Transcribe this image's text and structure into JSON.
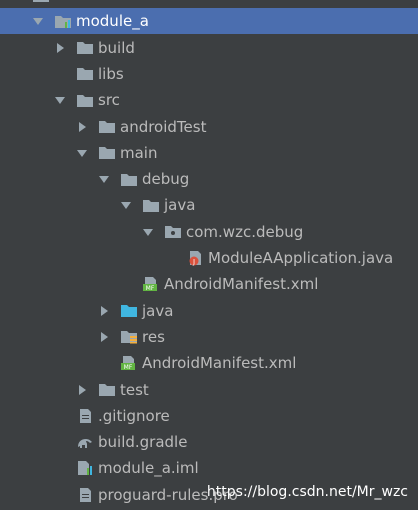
{
  "tree": {
    "items": [
      {
        "label": "",
        "depth": 0,
        "arrow": "down",
        "icon": "folder-icon",
        "selected": false,
        "clipped": true
      },
      {
        "label": "module_a",
        "depth": 1,
        "arrow": "down",
        "icon": "module-folder-icon",
        "selected": true
      },
      {
        "label": "build",
        "depth": 2,
        "arrow": "right",
        "icon": "folder-icon"
      },
      {
        "label": "libs",
        "depth": 2,
        "arrow": "none",
        "icon": "folder-icon"
      },
      {
        "label": "src",
        "depth": 2,
        "arrow": "down",
        "icon": "folder-icon"
      },
      {
        "label": "androidTest",
        "depth": 3,
        "arrow": "right",
        "icon": "folder-icon"
      },
      {
        "label": "main",
        "depth": 3,
        "arrow": "down",
        "icon": "folder-icon"
      },
      {
        "label": "debug",
        "depth": 4,
        "arrow": "down",
        "icon": "folder-icon"
      },
      {
        "label": "java",
        "depth": 5,
        "arrow": "down",
        "icon": "folder-icon"
      },
      {
        "label": "com.wzc.debug",
        "depth": 6,
        "arrow": "down",
        "icon": "package-icon"
      },
      {
        "label": "ModuleAApplication.java",
        "depth": 7,
        "arrow": "none",
        "icon": "java-class-icon"
      },
      {
        "label": "AndroidManifest.xml",
        "depth": 5,
        "arrow": "none",
        "icon": "manifest-icon"
      },
      {
        "label": "java",
        "depth": 4,
        "arrow": "right",
        "icon": "source-folder-icon"
      },
      {
        "label": "res",
        "depth": 4,
        "arrow": "right",
        "icon": "resource-folder-icon"
      },
      {
        "label": "AndroidManifest.xml",
        "depth": 4,
        "arrow": "none",
        "icon": "manifest-icon"
      },
      {
        "label": "test",
        "depth": 3,
        "arrow": "right",
        "icon": "folder-icon"
      },
      {
        "label": ".gitignore",
        "depth": 2,
        "arrow": "none",
        "icon": "text-file-icon"
      },
      {
        "label": "build.gradle",
        "depth": 2,
        "arrow": "none",
        "icon": "gradle-icon"
      },
      {
        "label": "module_a.iml",
        "depth": 2,
        "arrow": "none",
        "icon": "iml-file-icon"
      },
      {
        "label": "proguard-rules.pro",
        "depth": 2,
        "arrow": "none",
        "icon": "text-file-icon"
      }
    ]
  },
  "watermark": "https://blog.csdn.net/Mr_wzc",
  "colors": {
    "background": "#3c3f41",
    "selection": "#4b6eaf",
    "text": "#bbbbbb",
    "folder": "#9aa7b0",
    "source_folder": "#40b6e0"
  }
}
